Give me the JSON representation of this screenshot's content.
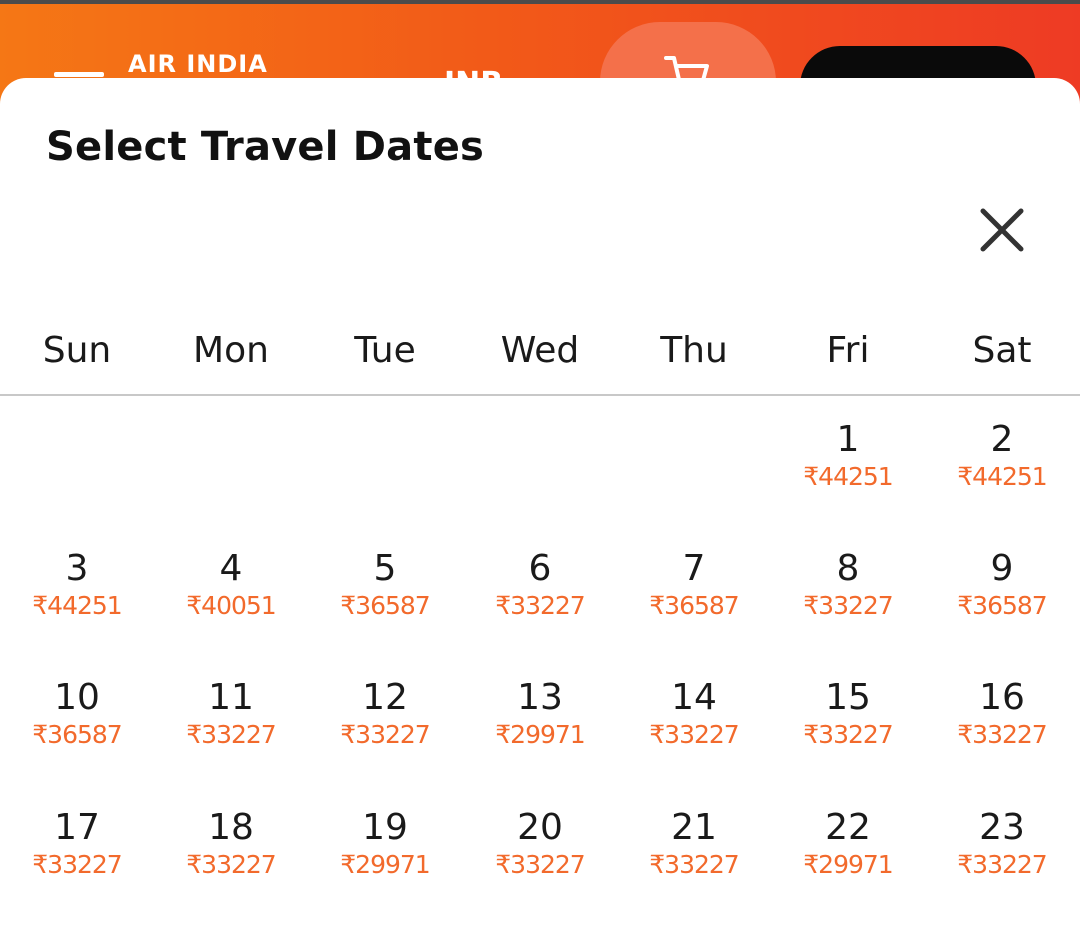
{
  "header": {
    "brand": "AIR INDIA",
    "currency": "INR",
    "colors": {
      "gradient_start": "#f57715",
      "gradient_end": "#ee3b24",
      "cart_bg": "#f4704a",
      "login_bg": "#0a0a0a"
    },
    "icons": {
      "menu": "hamburger-icon",
      "cart": "cart-icon"
    }
  },
  "modal": {
    "title": "Select Travel Dates",
    "close_icon": "close-icon",
    "weekdays": [
      "Sun",
      "Mon",
      "Tue",
      "Wed",
      "Thu",
      "Fri",
      "Sat"
    ],
    "first_weekday_index": 5,
    "days": [
      {
        "day": "1",
        "price": "₹44251"
      },
      {
        "day": "2",
        "price": "₹44251"
      },
      {
        "day": "3",
        "price": "₹44251"
      },
      {
        "day": "4",
        "price": "₹40051"
      },
      {
        "day": "5",
        "price": "₹36587"
      },
      {
        "day": "6",
        "price": "₹33227"
      },
      {
        "day": "7",
        "price": "₹36587"
      },
      {
        "day": "8",
        "price": "₹33227"
      },
      {
        "day": "9",
        "price": "₹36587"
      },
      {
        "day": "10",
        "price": "₹36587"
      },
      {
        "day": "11",
        "price": "₹33227"
      },
      {
        "day": "12",
        "price": "₹33227"
      },
      {
        "day": "13",
        "price": "₹29971"
      },
      {
        "day": "14",
        "price": "₹33227"
      },
      {
        "day": "15",
        "price": "₹33227"
      },
      {
        "day": "16",
        "price": "₹33227"
      },
      {
        "day": "17",
        "price": "₹33227"
      },
      {
        "day": "18",
        "price": "₹33227"
      },
      {
        "day": "19",
        "price": "₹29971"
      },
      {
        "day": "20",
        "price": "₹33227"
      },
      {
        "day": "21",
        "price": "₹33227"
      },
      {
        "day": "22",
        "price": "₹29971"
      },
      {
        "day": "23",
        "price": "₹33227"
      }
    ],
    "colors": {
      "price": "#f26a2c",
      "text": "#1a1a1a"
    }
  }
}
